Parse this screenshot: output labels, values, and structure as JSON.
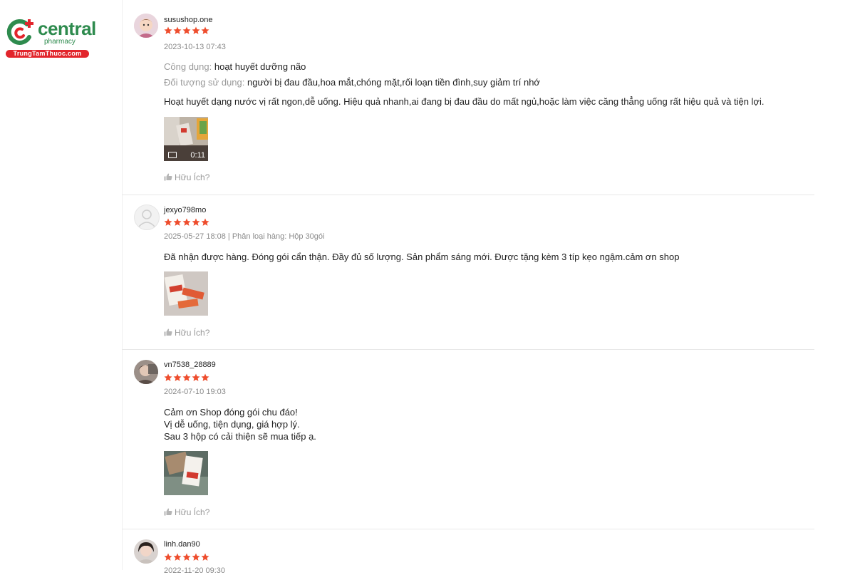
{
  "brand": {
    "name": "central",
    "sub": "pharmacy",
    "badge": "TrungTamThuoc.com",
    "colors": {
      "green": "#2e8b4e",
      "red": "#e2252c"
    }
  },
  "star_color": "#ee4d2d",
  "helpful_label": "Hữu Ích?",
  "reviews": [
    {
      "username": "susushop.one",
      "rating": 5,
      "meta": "2023-10-13 07:43",
      "fields": [
        {
          "key": "Công dụng:",
          "value": "hoạt huyết dưỡng não"
        },
        {
          "key": "Đối tượng sử dụng:",
          "value": "người bị đau đầu,hoa mắt,chóng mặt,rối loạn tiền đình,suy giảm trí nhớ"
        }
      ],
      "text": "Hoạt huyết dạng nước vị rất ngon,dễ uống. Hiệu quả nhanh,ai đang bị đau đầu do mất ngủ,hoặc làm việc căng thẳng uống rất hiệu quả và tiện lợi.",
      "media": {
        "type": "video",
        "duration": "0:11"
      }
    },
    {
      "username": "jexyo798mo",
      "rating": 5,
      "meta": "2025-05-27 18:08 | Phân loại hàng: Hộp 30gói",
      "text": "Đã nhận được hàng. Đóng gói cẩn thận. Đầy đủ số lượng. Sản phẩm sáng mới. Được tặng kèm 3 típ kẹo ngậm.cảm ơn shop",
      "media": {
        "type": "image"
      }
    },
    {
      "username": "vn7538_28889",
      "rating": 5,
      "meta": "2024-07-10 19:03",
      "text_lines": [
        "Cảm ơn Shop đóng gói chu đáo!",
        "Vị dễ uống, tiện dụng, giá hợp lý.",
        "Sau 3 hộp có cải thiện sẽ mua tiếp ạ."
      ],
      "media": {
        "type": "image"
      }
    },
    {
      "username": "linh.dan90",
      "rating": 5,
      "meta": "2022-11-20 09:30"
    }
  ]
}
